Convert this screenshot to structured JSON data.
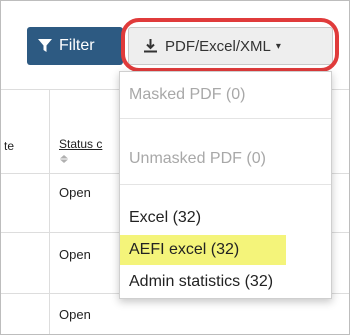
{
  "toolbar": {
    "filter_label": "Filter",
    "filter_icon": "funnel-icon",
    "export_label": "PDF/Excel/XML",
    "export_icon": "download-icon",
    "export_caret": "▾"
  },
  "table": {
    "headers": [
      "te",
      "Status c"
    ],
    "rows": [
      {
        "status": "Open"
      },
      {
        "status": "Open"
      },
      {
        "status": "Open"
      }
    ]
  },
  "export_menu": {
    "items": [
      {
        "label": "Masked PDF (0)",
        "disabled": true
      },
      {
        "label": "Unmasked PDF (0)",
        "disabled": true
      },
      {
        "label": "Excel (32)",
        "disabled": false
      },
      {
        "label": "AEFI excel (32)",
        "disabled": false,
        "highlighted": true
      },
      {
        "label": "Admin statistics (32)",
        "disabled": false
      }
    ]
  },
  "colors": {
    "filter_button": "#2d5a82",
    "highlight_ring": "#e03b3b",
    "highlight_fill": "#f4f47a"
  }
}
